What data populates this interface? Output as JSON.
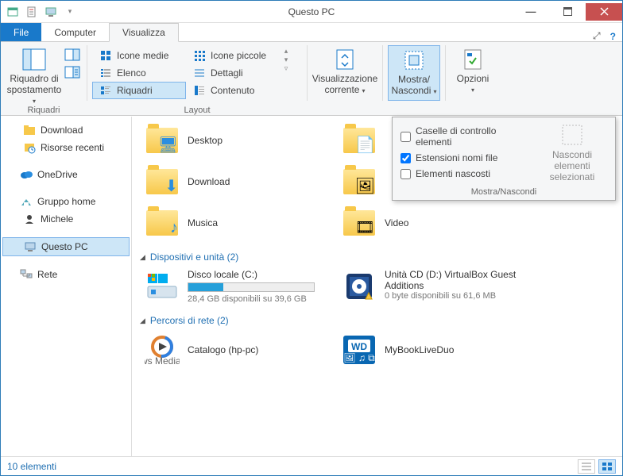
{
  "window": {
    "title": "Questo PC"
  },
  "tabs": {
    "file": "File",
    "computer": "Computer",
    "view": "Visualizza"
  },
  "ribbon": {
    "riquadri": {
      "label": "Riquadri",
      "nav_pane": "Riquadro di spostamento"
    },
    "layout": {
      "label": "Layout",
      "icone_medie": "Icone medie",
      "icone_piccole": "Icone piccole",
      "elenco": "Elenco",
      "dettagli": "Dettagli",
      "riquadri": "Riquadri",
      "contenuto": "Contenuto"
    },
    "current_view": "Visualizzazione corrente",
    "show_hide": "Mostra/ Nascondi",
    "options": "Opzioni"
  },
  "dropdown": {
    "checkboxes_items": "Caselle di controllo elementi",
    "filename_ext": "Estensioni nomi file",
    "hidden_items": "Elementi nascosti",
    "hide_selected": "Nascondi elementi selezionati",
    "footer": "Mostra/Nascondi"
  },
  "sections": {
    "devices": "Dispositivi e unità (2)",
    "network": "Percorsi di rete (2)"
  },
  "nav": {
    "download": "Download",
    "recent": "Risorse recenti",
    "onedrive": "OneDrive",
    "homegroup": "Gruppo home",
    "michele": "Michele",
    "this_pc": "Questo PC",
    "network_loc": "Rete"
  },
  "folders": {
    "desktop": "Desktop",
    "download": "Download",
    "music": "Musica",
    "video": "Video"
  },
  "drives": {
    "local": {
      "name": "Disco locale (C:)",
      "sub": "28,4 GB disponibili su 39,6 GB",
      "fill_pct": 28
    },
    "cd": {
      "name": "Unità CD (D:) VirtualBox Guest Additions",
      "sub": "0 byte disponibili su 61,6 MB"
    }
  },
  "netloc": {
    "catalogo": "Catalogo (hp-pc)",
    "mybook": "MyBookLiveDuo"
  },
  "status": {
    "count": "10 elementi"
  }
}
